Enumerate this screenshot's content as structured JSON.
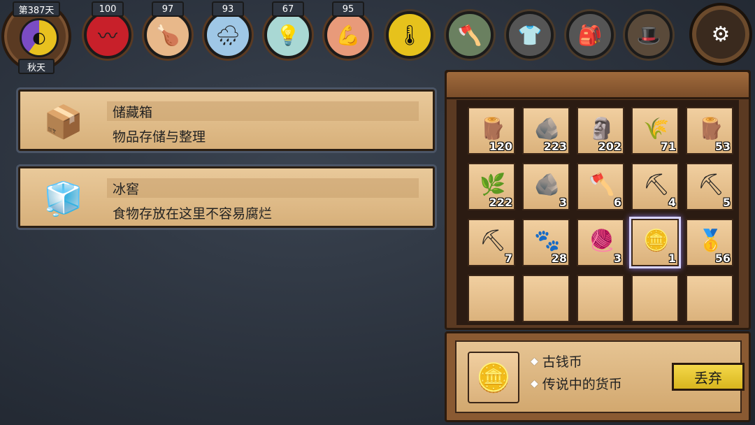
{
  "status": {
    "day": "第387天",
    "season": "秋天",
    "stats": [
      {
        "name": "health",
        "value": "100",
        "icon": "heartbeat-icon",
        "color": "#c8202a",
        "glyph": "〰"
      },
      {
        "name": "hunger",
        "value": "97",
        "icon": "drumstick-icon",
        "color": "#e8b88a",
        "glyph": "🍗"
      },
      {
        "name": "thirst",
        "value": "93",
        "icon": "rain-cloud-icon",
        "color": "#9fc7e6",
        "glyph": "🌧"
      },
      {
        "name": "sanity",
        "value": "67",
        "icon": "lightbulb-icon",
        "color": "#a9d8d4",
        "glyph": "💡"
      },
      {
        "name": "strength",
        "value": "95",
        "icon": "muscle-icon",
        "color": "#e89a7a",
        "glyph": "💪"
      }
    ],
    "extras": [
      {
        "icon": "thermometer-icon",
        "color": "#e6c21c",
        "glyph": "🌡"
      },
      {
        "icon": "axe-icon",
        "color": "#6a8060",
        "glyph": "🪓"
      },
      {
        "icon": "armor-slot-icon",
        "color": "#555555",
        "glyph": "👕"
      },
      {
        "icon": "backpack-slot-icon",
        "color": "#555555",
        "glyph": "🎒"
      },
      {
        "icon": "hat-icon",
        "color": "#5a4a3a",
        "glyph": "🎩"
      }
    ],
    "settings_glyph": "⚙"
  },
  "buildings": [
    {
      "title": "储藏箱",
      "desc": "物品存储与整理",
      "icon": "storage-chest-icon",
      "glyph": "📦"
    },
    {
      "title": "冰窖",
      "desc": "食物存放在这里不容易腐烂",
      "icon": "ice-cellar-icon",
      "glyph": "🧊"
    }
  ],
  "inventory": [
    {
      "icon": "log-icon",
      "glyph": "🪵",
      "count": "120"
    },
    {
      "icon": "stones-icon",
      "glyph": "🪨",
      "count": "223"
    },
    {
      "icon": "flint-icon",
      "glyph": "🗿",
      "count": "202"
    },
    {
      "icon": "grass-icon",
      "glyph": "🌾",
      "count": "71"
    },
    {
      "icon": "firewood-icon",
      "glyph": "🪵",
      "count": "53"
    },
    {
      "icon": "twigs-icon",
      "glyph": "🌿",
      "count": "222"
    },
    {
      "icon": "rune-stone-icon",
      "glyph": "🪨",
      "count": "3"
    },
    {
      "icon": "axe-icon",
      "glyph": "🪓",
      "count": "6"
    },
    {
      "icon": "shovel-icon",
      "glyph": "⛏",
      "count": "4"
    },
    {
      "icon": "pickaxe-icon",
      "glyph": "⛏",
      "count": "5"
    },
    {
      "icon": "scythe-icon",
      "glyph": "⛏",
      "count": "7"
    },
    {
      "icon": "fur-icon",
      "glyph": "🐾",
      "count": "28"
    },
    {
      "icon": "rope-roll-icon",
      "glyph": "🧶",
      "count": "3"
    },
    {
      "icon": "ancient-coin-icon",
      "glyph": "🪙",
      "count": "1",
      "selected": true
    },
    {
      "icon": "gold-nugget-icon",
      "glyph": "🥇",
      "count": "56"
    },
    {
      "icon": "",
      "glyph": "",
      "count": ""
    },
    {
      "icon": "",
      "glyph": "",
      "count": ""
    },
    {
      "icon": "",
      "glyph": "",
      "count": ""
    },
    {
      "icon": "",
      "glyph": "",
      "count": ""
    },
    {
      "icon": "",
      "glyph": "",
      "count": ""
    }
  ],
  "detail": {
    "name": "古钱币",
    "desc": "传说中的货币",
    "icon": "ancient-coin-icon",
    "glyph": "🪙",
    "discard_label": "丢弃"
  }
}
